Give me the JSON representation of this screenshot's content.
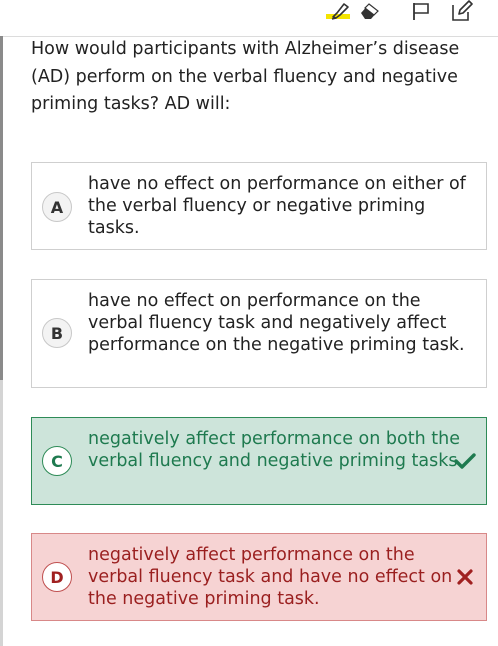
{
  "question": {
    "text": "How would participants with Alzheimer’s disease (AD) perform on the verbal fluency and negative priming tasks? AD will:"
  },
  "toolbar": {
    "icons": [
      "highlighter-icon",
      "eraser-icon",
      "flag-icon",
      "edit-icon"
    ]
  },
  "options": [
    {
      "letter": "A",
      "text": "have no effect on performance on either of the verbal fluency or negative priming tasks.",
      "state": "neutral"
    },
    {
      "letter": "B",
      "text": "have no effect on performance on the verbal fluency task and negatively affect performance on the negative priming task.",
      "state": "neutral"
    },
    {
      "letter": "C",
      "text": "negatively affect performance on both the verbal fluency and negative priming tasks.",
      "state": "correct",
      "mark_icon": "check-icon"
    },
    {
      "letter": "D",
      "text": "negatively affect performance on the verbal fluency task and have no effect on the negative priming task.",
      "state": "incorrect",
      "mark_icon": "x-icon"
    }
  ],
  "colors": {
    "correct_bg": "#cde4da",
    "correct_text": "#1e7a4f",
    "incorrect_bg": "#f6d3d3",
    "incorrect_text": "#9a1f1f",
    "highlight": "#f4e400"
  }
}
